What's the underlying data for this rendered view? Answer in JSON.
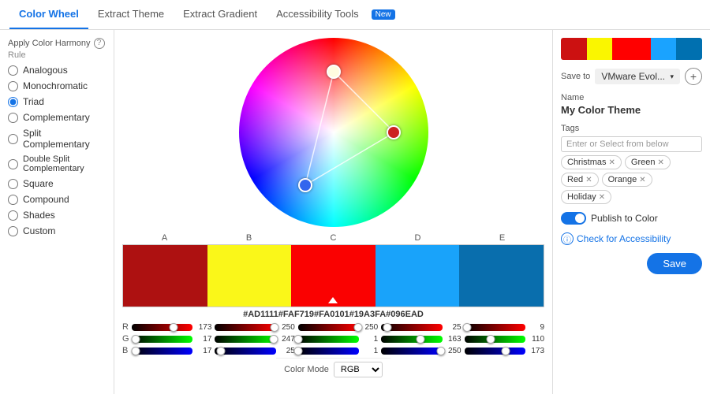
{
  "tabs": [
    {
      "label": "Color Wheel",
      "active": true
    },
    {
      "label": "Extract Theme",
      "active": false
    },
    {
      "label": "Extract Gradient",
      "active": false
    },
    {
      "label": "Accessibility Tools",
      "active": false
    }
  ],
  "new_badge": "New",
  "harmony": {
    "label": "Apply Color Harmony",
    "sublabel": "Rule",
    "options": [
      {
        "id": "analogous",
        "label": "Analogous",
        "checked": false
      },
      {
        "id": "monochromatic",
        "label": "Monochromatic",
        "checked": false
      },
      {
        "id": "triad",
        "label": "Triad",
        "checked": true
      },
      {
        "id": "complementary",
        "label": "Complementary",
        "checked": false
      },
      {
        "id": "split-complementary",
        "label": "Split Complementary",
        "checked": false
      },
      {
        "id": "double-split-complementary",
        "label": "Double Split Complementary",
        "checked": false
      },
      {
        "id": "square",
        "label": "Square",
        "checked": false
      },
      {
        "id": "compound",
        "label": "Compound",
        "checked": false
      },
      {
        "id": "shades",
        "label": "Shades",
        "checked": false
      },
      {
        "id": "custom",
        "label": "Custom",
        "checked": false
      }
    ]
  },
  "swatches": {
    "labels": [
      "A",
      "B",
      "C",
      "D",
      "E"
    ],
    "colors": [
      "#AD1111",
      "#FAF719",
      "#FA0101",
      "#19A3FA",
      "#096EAD"
    ],
    "hex": [
      "#AD1111",
      "#FAF719",
      "#FA0101",
      "#19A3FA",
      "#096EAD"
    ],
    "active_index": 2
  },
  "sliders": {
    "columns": [
      {
        "hex": "#AD1111",
        "r": 173,
        "g": 17,
        "b": 17,
        "r_pct": 68,
        "g_pct": 7,
        "b_pct": 7
      },
      {
        "hex": "#FAF719",
        "r": 250,
        "g": 247,
        "b": 25,
        "r_pct": 98,
        "g_pct": 97,
        "b_pct": 10
      },
      {
        "hex": "#FA0101",
        "r": 250,
        "g": 1,
        "b": 1,
        "r_pct": 98,
        "g_pct": 0,
        "b_pct": 0
      },
      {
        "hex": "#19A3FA",
        "r": 25,
        "g": 163,
        "b": 250,
        "r_pct": 10,
        "g_pct": 64,
        "b_pct": 98
      },
      {
        "hex": "#096EAD",
        "r": 9,
        "g": 110,
        "b": 173,
        "r_pct": 4,
        "g_pct": 43,
        "b_pct": 68
      }
    ]
  },
  "color_mode": "RGB",
  "right_panel": {
    "save_to_label": "Save to",
    "save_to_value": "VMware Evol...",
    "name_label": "Name",
    "name_value": "My Color Theme",
    "tags_label": "Tags",
    "tags_placeholder": "Enter or Select from below",
    "tags": [
      {
        "label": "Christmas"
      },
      {
        "label": "Green"
      },
      {
        "label": "Red"
      },
      {
        "label": "Orange"
      },
      {
        "label": "Holiday"
      }
    ],
    "publish_label": "Publish to Color",
    "accessibility_label": "Check for Accessibility",
    "save_label": "Save"
  },
  "preview_colors": [
    "#cc1111",
    "#faf600",
    "#ff0000",
    "#1aa3ff",
    "#0070b0"
  ]
}
